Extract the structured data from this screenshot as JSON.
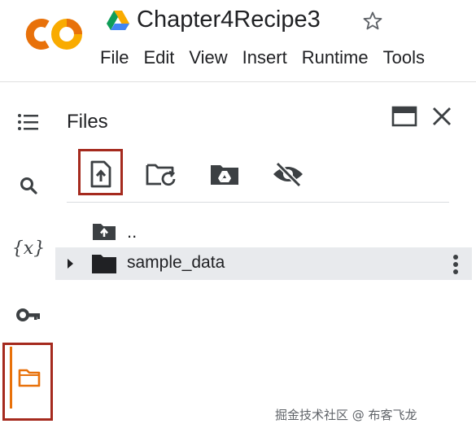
{
  "header": {
    "logo_text": "CO",
    "notebook_title": "Chapter4Recipe3",
    "menu": [
      "File",
      "Edit",
      "View",
      "Insert",
      "Runtime",
      "Tools"
    ]
  },
  "rail": {
    "icons": [
      "table-of-contents-icon",
      "search-icon",
      "variables-icon",
      "secrets-key-icon",
      "files-icon"
    ],
    "variables_label": "{x}"
  },
  "files_panel": {
    "title": "Files",
    "toolbar": [
      "upload-file-icon",
      "refresh-folder-icon",
      "mount-drive-icon",
      "hide-files-icon"
    ],
    "parent_dir_label": "..",
    "items": [
      {
        "name": "sample_data",
        "type": "folder"
      }
    ]
  },
  "watermark": "掘金技术社区 @ 布客飞龙",
  "colors": {
    "logo_orange": "#e8710a",
    "logo_yellow": "#f9ab00",
    "highlight_red": "#a52a1e",
    "row_selected": "#e8eaed"
  }
}
